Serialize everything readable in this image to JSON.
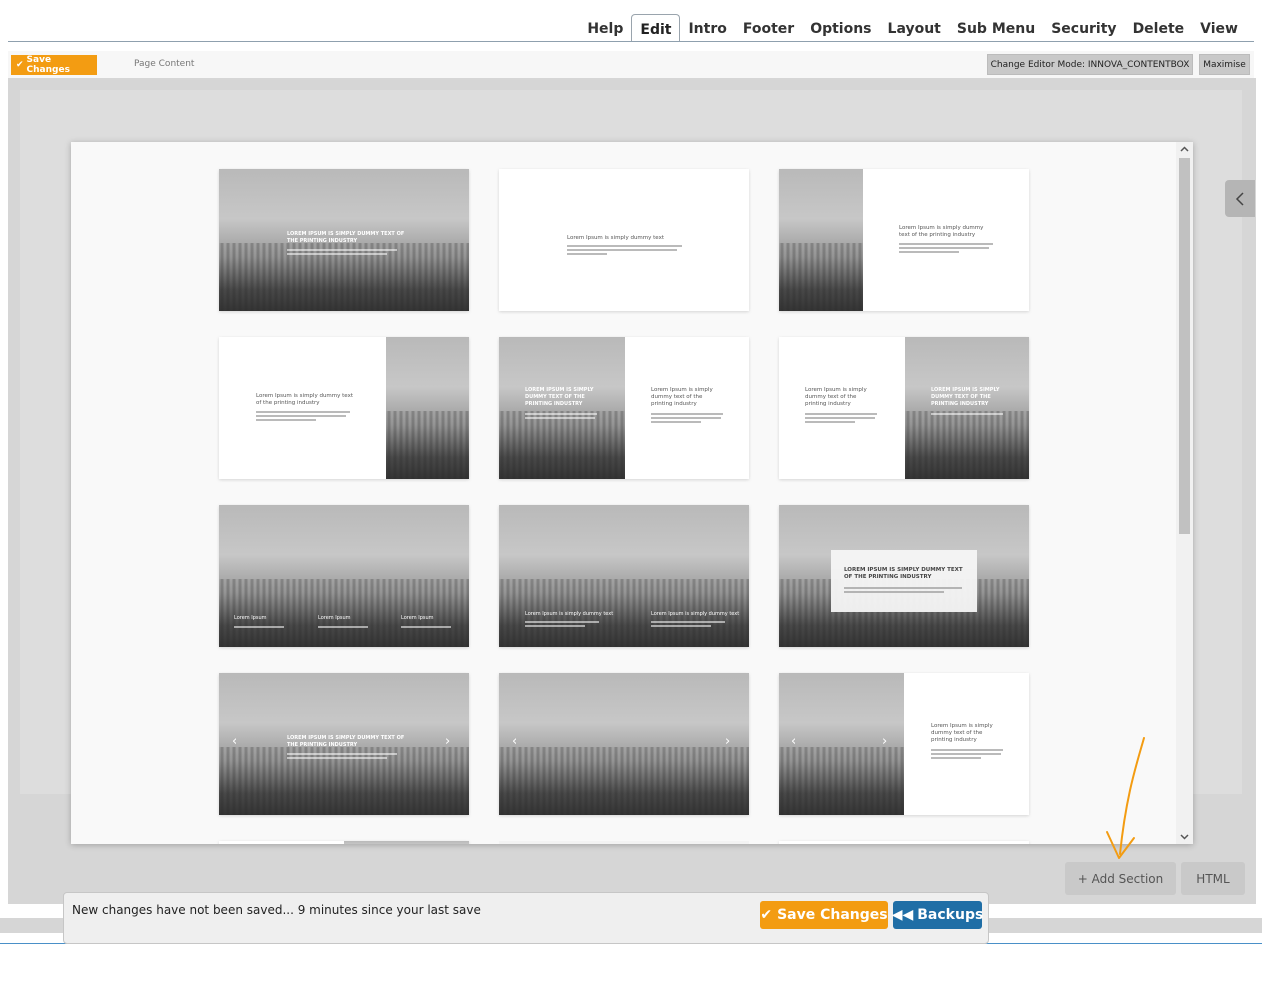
{
  "nav": {
    "tabs": [
      {
        "label": "Help"
      },
      {
        "label": "Edit",
        "active": true
      },
      {
        "label": "Intro"
      },
      {
        "label": "Footer"
      },
      {
        "label": "Options"
      },
      {
        "label": "Layout"
      },
      {
        "label": "Sub Menu"
      },
      {
        "label": "Security"
      },
      {
        "label": "Delete"
      },
      {
        "label": "View"
      }
    ]
  },
  "toolbar": {
    "save_label": "Save Changes",
    "page_content_label": "Page Content",
    "editor_mode_label": "Change Editor Mode: INNOVA_CONTENTBOX",
    "maximise_label": "Maximise"
  },
  "thumbs": {
    "heading_caps": "LOREM IPSUM IS SIMPLY DUMMY TEXT OF THE PRINTING INDUSTRY",
    "heading_caps_short": "LOREM IPSUM IS SIMPLY DUMMY TEXT OF THE PRINTING INDUSTRY",
    "heading_plain": "Lorem Ipsum is simply dummy text",
    "heading_plain_two": "Lorem Ipsum is simply dummy text of the printing industry",
    "col_title": "Lorem Ipsum",
    "col_title_long": "Lorem Ipsum is simply dummy text"
  },
  "actions": {
    "add_section_label": "+ Add Section",
    "html_label": "HTML"
  },
  "notification": {
    "text": "New changes have not been saved... 9 minutes since your last save",
    "save_label": "Save Changes",
    "backups_label": "Backups"
  },
  "colors": {
    "accent_orange": "#f39c12",
    "backup_blue": "#1f6ea6"
  }
}
